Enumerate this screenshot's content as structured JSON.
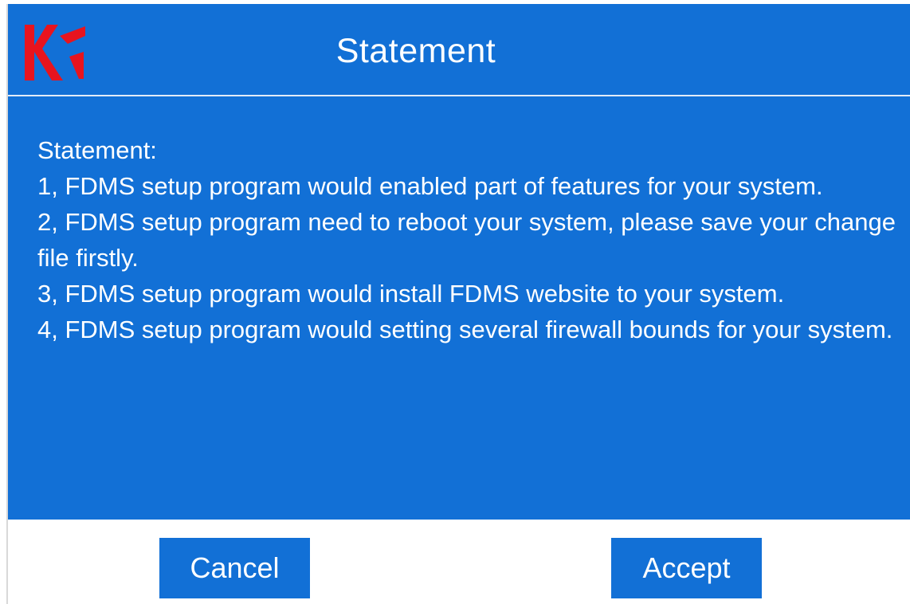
{
  "dialog": {
    "title": "Statement",
    "logo_icon": "fdms-logo-icon",
    "colors": {
      "primary": "#1270d6",
      "logo_red": "#e8141e",
      "text": "#ffffff",
      "footer_bg": "#ffffff"
    }
  },
  "statement": {
    "lines": [
      "Statement:",
      "1, FDMS setup program would enabled part of features for your system.",
      "2, FDMS setup program need to reboot your system, please save your change file firstly.",
      "3, FDMS setup program would install FDMS website to your system.",
      "4, FDMS setup program would setting several firewall bounds for your system."
    ]
  },
  "buttons": {
    "cancel_label": "Cancel",
    "accept_label": "Accept"
  }
}
